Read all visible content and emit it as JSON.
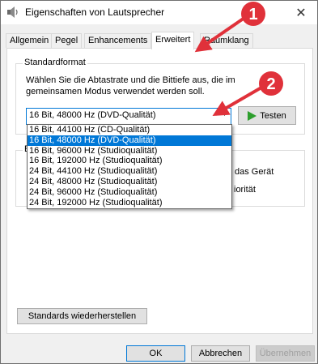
{
  "window": {
    "title": "Eigenschaften von Lautsprecher",
    "close_glyph": "✕"
  },
  "tabs": [
    {
      "label": "Allgemein"
    },
    {
      "label": "Pegel"
    },
    {
      "label": "Enhancements"
    },
    {
      "label": "Erweitert",
      "active": true
    },
    {
      "label": "Raumklang"
    }
  ],
  "standard_format": {
    "group_title": "Standardformat",
    "description": "Wählen Sie die Abtastrate und die Bittiefe aus, die im gemeinsamen Modus verwendet werden soll.",
    "selected_value": "16 Bit, 48000 Hz (DVD-Qualität)",
    "test_button": "Testen",
    "options": [
      "16 Bit, 44100 Hz (CD-Qualität)",
      "16 Bit, 48000 Hz (DVD-Qualität)",
      "16 Bit, 96000 Hz (Studioqualität)",
      "16 Bit, 192000 Hz (Studioqualität)",
      "24 Bit, 44100 Hz (Studioqualität)",
      "24 Bit, 48000 Hz (Studioqualität)",
      "24 Bit, 96000 Hz (Studioqualität)",
      "24 Bit, 192000 Hz (Studioqualität)"
    ],
    "selected_index": 1
  },
  "exclusive_mode": {
    "group_title_partial": "E",
    "text_line1_partial": "das Gerät",
    "text_line2_partial": "iorität"
  },
  "restore_button": "Standards wiederherstellen",
  "footer": {
    "ok": "OK",
    "cancel": "Abbrechen",
    "apply": "Übernehmen"
  },
  "annotations": [
    {
      "number": "1",
      "color": "#e0313a"
    },
    {
      "number": "2",
      "color": "#e0313a"
    }
  ]
}
